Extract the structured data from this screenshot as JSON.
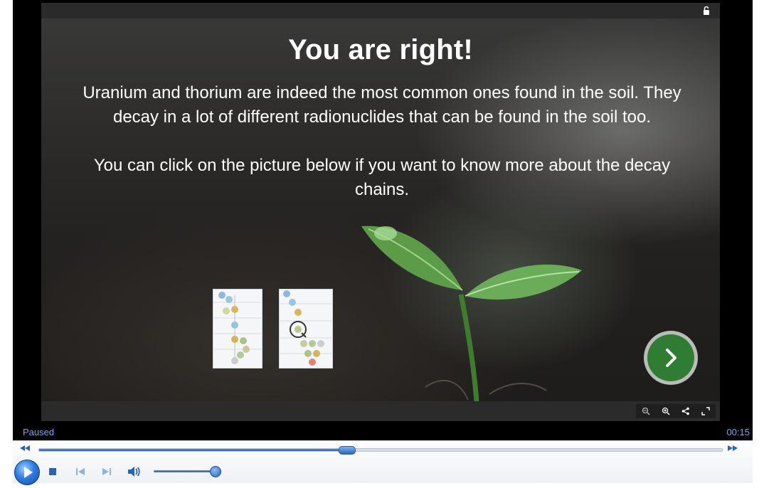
{
  "slide": {
    "title": "You are right!",
    "paragraph1": "Uranium and thorium are indeed the most common ones found in the soil. They decay in a lot of different radionuclides that can be found in the soil too.",
    "paragraph2": "You can click on the picture below if you want to know more about the decay chains.",
    "next_button_icon": "chevron-right-icon",
    "thumbnails": [
      "uranium-decay-chain-diagram",
      "thorium-decay-chain-diagram"
    ],
    "toolbar_icons": [
      "zoom-out-icon",
      "zoom-in-icon",
      "share-icon",
      "fullscreen-icon"
    ],
    "corner_icon": "lock-icon"
  },
  "player": {
    "status": "Paused",
    "time": "00:15",
    "seek_progress": 0.45,
    "volume": 0.9,
    "icons": [
      "play-icon",
      "stop-icon",
      "previous-icon",
      "next-icon",
      "volume-icon",
      "rewind-icon",
      "fast-forward-icon"
    ]
  },
  "colors": {
    "accent_green": "#2e7d32",
    "player_blue": "#2b63b7",
    "status_text": "#6fa8ff"
  }
}
